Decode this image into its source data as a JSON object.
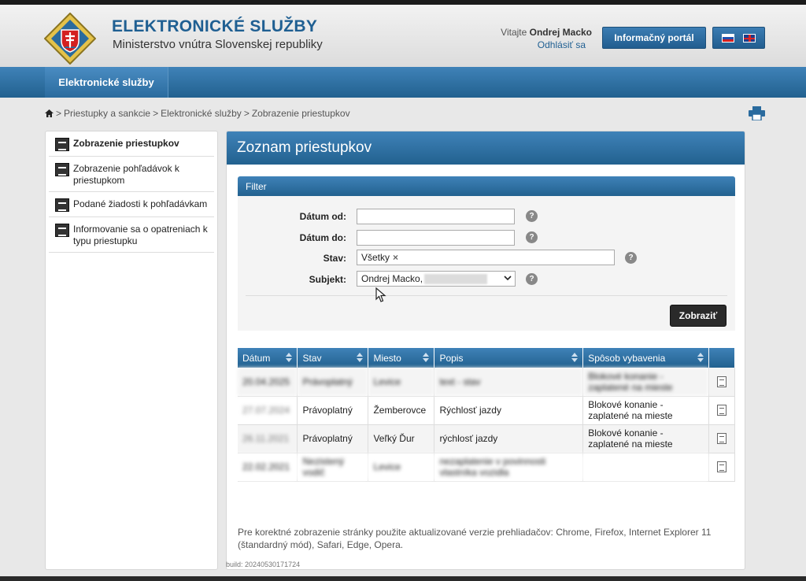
{
  "header": {
    "title": "ELEKTRONICKÉ SLUŽBY",
    "subtitle": "Ministerstvo vnútra Slovenskej republiky",
    "welcome_prefix": "Vitajte",
    "user_name": "Ondrej Macko",
    "logout": "Odhlásiť sa",
    "portal_button": "Informačný portál"
  },
  "nav": {
    "item": "Elektronické služby"
  },
  "breadcrumb": [
    "Priestupky a sankcie",
    "Elektronické služby",
    "Zobrazenie priestupkov"
  ],
  "sidebar": {
    "items": [
      {
        "label": "Zobrazenie priestupkov"
      },
      {
        "label": "Zobrazenie pohľadávok k priestupkom"
      },
      {
        "label": "Podané žiadosti k pohľadávkam"
      },
      {
        "label": "Informovanie sa o opatreniach k typu priestupku"
      }
    ]
  },
  "main": {
    "title": "Zoznam priestupkov",
    "filter": {
      "heading": "Filter",
      "date_from_label": "Dátum od:",
      "date_from_value": "",
      "date_to_label": "Dátum do:",
      "date_to_value": "",
      "state_label": "Stav:",
      "state_tag": "Všetky",
      "subject_label": "Subjekt:",
      "subject_value": "Ondrej Macko,",
      "help": "?",
      "show_button": "Zobraziť"
    },
    "table": {
      "columns": [
        "Dátum",
        "Stav",
        "Miesto",
        "Popis",
        "Spôsob vybavenia"
      ],
      "rows": [
        {
          "date": "20.04.2025",
          "state": "Právoplatný",
          "place": "Levice",
          "desc": "text - stav",
          "method": "Blokové konanie - zaplatené na mieste",
          "blurred": true
        },
        {
          "date": "27.07.2024",
          "state": "Právoplatný",
          "place": "Žemberovce",
          "desc": "Rýchlosť jazdy",
          "method": "Blokové konanie - zaplatené na mieste",
          "blurred": false
        },
        {
          "date": "26.11.2021",
          "state": "Právoplatný",
          "place": "Veľký Ďur",
          "desc": "rýchlosť jazdy",
          "method": "Blokové konanie - zaplatené na mieste",
          "blurred": false
        },
        {
          "date": "22.02.2021",
          "state": "Nezistený vodič",
          "place": "Levice",
          "desc": "nezaplatenie v povinnosti vlastníka vozidla",
          "method": "",
          "blurred": true
        }
      ]
    },
    "footnote": "Pre korektné zobrazenie stránky použite aktualizované verzie prehliadačov: Chrome, Firefox, Internet Explorer 11 (štandardný mód), Safari, Edge, Opera."
  },
  "build": "build: 20240530171724",
  "colors": {
    "primary": "#2a6b9e",
    "title": "#1f5f92",
    "button_dark": "#2a2a2a"
  },
  "icons": [
    "coat-of-arms-icon",
    "home-icon",
    "print-icon",
    "document-icon",
    "help-icon",
    "sort-icon",
    "detail-icon",
    "flag-sk-icon",
    "flag-en-icon"
  ]
}
